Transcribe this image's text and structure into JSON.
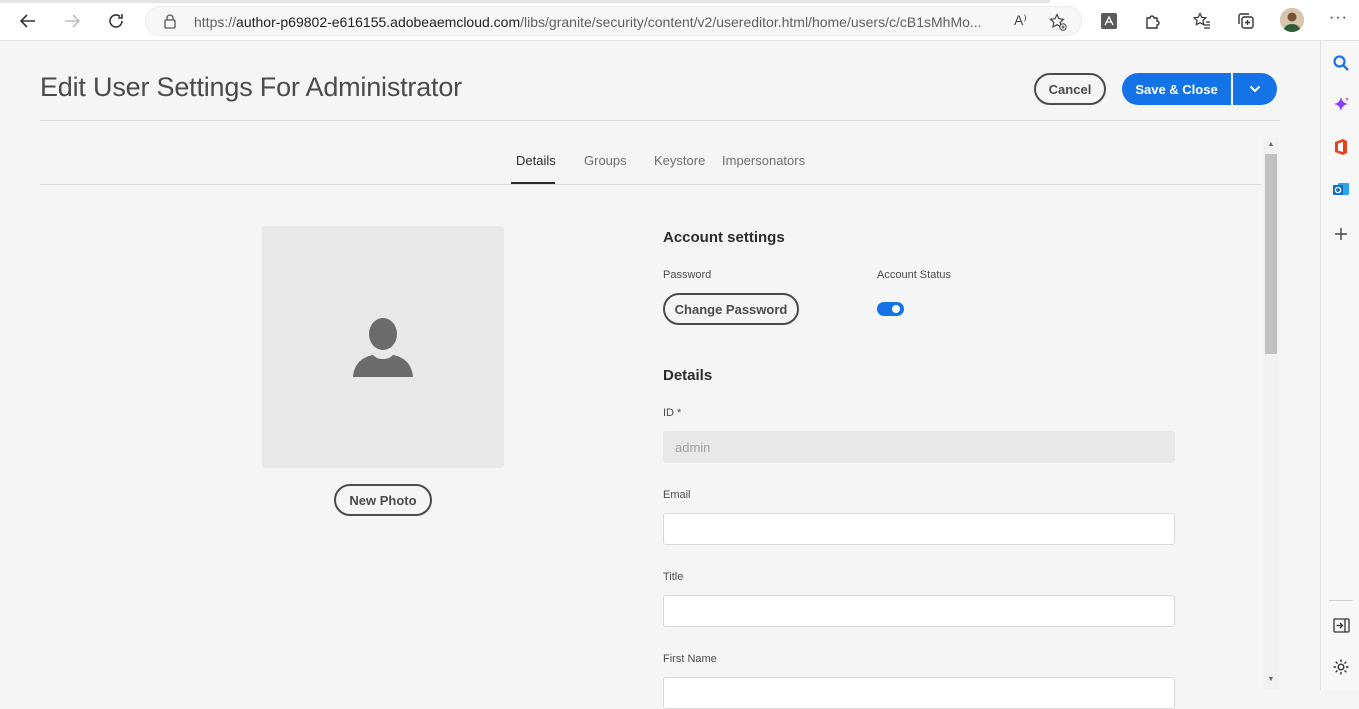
{
  "browser": {
    "url_prefix": "https://",
    "url_domain": "author-p69802-e616155.adobeaemcloud.com",
    "url_path": "/libs/granite/security/content/v2/usereditor.html/home/users/c/cB1sMhMo...",
    "read_aloud_label": "A⁾",
    "more_label": "···"
  },
  "header": {
    "title": "Edit User Settings For Administrator",
    "cancel_label": "Cancel",
    "save_label": "Save & Close"
  },
  "tabs": [
    {
      "label": "Details"
    },
    {
      "label": "Groups"
    },
    {
      "label": "Keystore"
    },
    {
      "label": "Impersonators"
    }
  ],
  "photo": {
    "new_photo_label": "New Photo"
  },
  "account_settings": {
    "heading": "Account settings",
    "password_label": "Password",
    "change_password_label": "Change Password",
    "account_status_label": "Account Status",
    "account_status_enabled": true
  },
  "details": {
    "heading": "Details",
    "id_label": "ID *",
    "id_value": "admin",
    "email_label": "Email",
    "email_value": "",
    "title_label": "Title",
    "title_value": "",
    "first_name_label": "First Name",
    "first_name_value": ""
  },
  "colors": {
    "accent": "#1473e6",
    "background": "#f5f5f5"
  }
}
